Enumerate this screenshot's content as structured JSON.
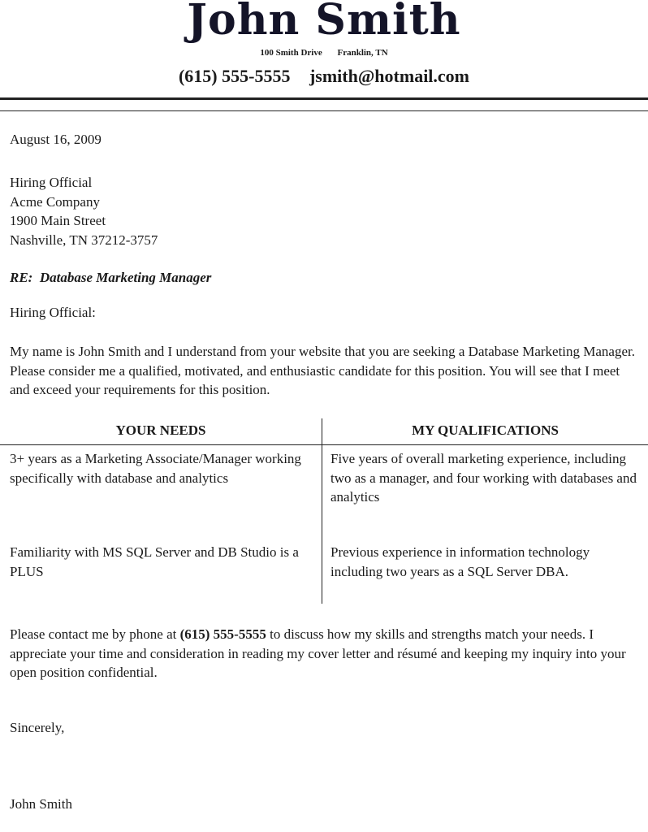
{
  "header": {
    "name": "John Smith",
    "street": "100 Smith Drive",
    "city": "Franklin, TN",
    "phone": "(615) 555-5555",
    "email": "jsmith@hotmail.com"
  },
  "letter": {
    "date": "August 16, 2009",
    "recipient": [
      "Hiring Official",
      "Acme Company",
      "1900 Main Street",
      "Nashville, TN 37212-3757"
    ],
    "re_label": "RE:",
    "re_subject": "Database Marketing Manager",
    "salutation": "Hiring Official:",
    "intro": "My name is John Smith and I understand from your website that you are seeking a Database Marketing Manager. Please consider me a qualified, motivated, and enthusiastic candidate for this position. You will see that I meet and exceed your requirements for this position.",
    "table": {
      "headers": [
        "YOUR NEEDS",
        "MY QUALIFICATIONS"
      ],
      "rows": [
        [
          "3+ years as a Marketing Associate/Manager working specifically with database and analytics",
          "Five years of overall marketing experience, including two as a manager, and four working with databases and analytics"
        ],
        [
          "Familiarity with MS SQL Server and DB Studio is a PLUS",
          "Previous experience in information technology including two years as a SQL Server DBA."
        ]
      ]
    },
    "closing_pre": "Please contact me by phone at ",
    "closing_phone": "(615) 555-5555",
    "closing_post": " to discuss how my skills and strengths match your needs. I appreciate your time and consideration in reading my cover letter and résumé and keeping my inquiry into your open position confidential.",
    "signoff": "Sincerely,",
    "signature": "John Smith"
  }
}
